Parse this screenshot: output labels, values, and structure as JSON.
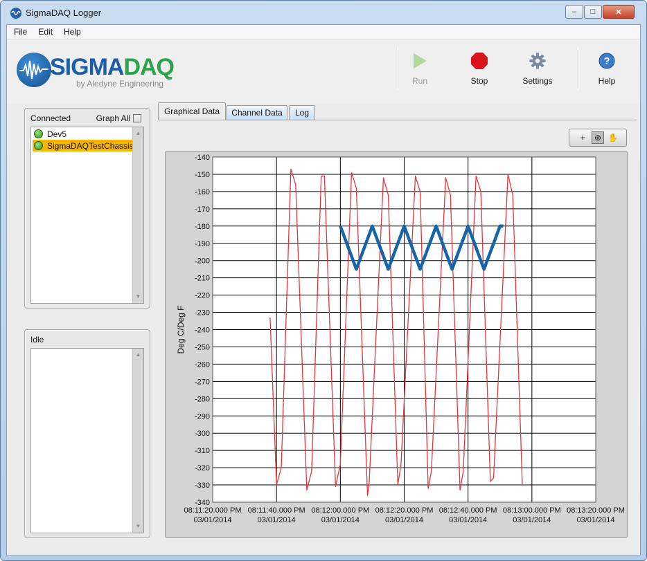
{
  "window": {
    "title": "SigmaDAQ Logger",
    "icon": "sigmadaq-app-icon"
  },
  "window_controls": {
    "minimize": "–",
    "maximize": "□",
    "close": "✕"
  },
  "menu": [
    {
      "label": "File"
    },
    {
      "label": "Edit"
    },
    {
      "label": "Help"
    }
  ],
  "logo": {
    "main_left": "SIGMA",
    "main_right": "DAQ",
    "sub": "by Aledyne Engineering",
    "icon": "sine-wave-logo-icon"
  },
  "toolbar": {
    "run": {
      "label": "Run",
      "icon": "play-icon",
      "enabled": false
    },
    "stop": {
      "label": "Stop",
      "icon": "stop-icon",
      "enabled": true
    },
    "settings": {
      "label": "Settings",
      "icon": "gear-icon",
      "enabled": true
    },
    "help": {
      "label": "Help",
      "icon": "help-icon",
      "enabled": true
    }
  },
  "connected_panel": {
    "title": "Connected",
    "graph_all_label": "Graph All",
    "graph_all_checked": false,
    "items": [
      {
        "label": "Dev5",
        "status": "green-led-icon",
        "selected": false
      },
      {
        "label": "SigmaDAQTestChassis",
        "status": "green-led-icon",
        "selected": true
      }
    ]
  },
  "idle_panel": {
    "title": "Idle",
    "items": []
  },
  "tabs": [
    {
      "label": "Graphical Data",
      "active": true
    },
    {
      "label": "Channel Data",
      "active": false
    },
    {
      "label": "Log",
      "active": false
    }
  ],
  "graph_tools": [
    {
      "name": "cursor-tool-icon",
      "glyph": "+",
      "pressed": false
    },
    {
      "name": "zoom-tool-icon",
      "glyph": "⊕",
      "pressed": true
    },
    {
      "name": "pan-tool-icon",
      "glyph": "✋",
      "pressed": false
    }
  ],
  "colors": {
    "selected_item": "#f7b500",
    "series_red": "#e8333a",
    "series_blue": "#1565a8",
    "logo_blue": "#1c5da6",
    "logo_green": "#2aa34a"
  },
  "chart_data": {
    "type": "line",
    "ylabel": "Deg C/Deg F",
    "xlabel": "",
    "ylim": [
      -340,
      -140
    ],
    "yticks": [
      -140,
      -150,
      -160,
      -170,
      -180,
      -190,
      -200,
      -210,
      -220,
      -230,
      -240,
      -250,
      -260,
      -270,
      -280,
      -290,
      -300,
      -310,
      -320,
      -330,
      -340
    ],
    "xlim_seconds": [
      0,
      120
    ],
    "xticks": [
      {
        "time": "08:11:20.000 PM",
        "date": "03/01/2014"
      },
      {
        "time": "08:11:40.000 PM",
        "date": "03/01/2014"
      },
      {
        "time": "08:12:00.000 PM",
        "date": "03/01/2014"
      },
      {
        "time": "08:12:20.000 PM",
        "date": "03/01/2014"
      },
      {
        "time": "08:12:40.000 PM",
        "date": "03/01/2014"
      },
      {
        "time": "08:13:00.000 PM",
        "date": "03/01/2014"
      },
      {
        "time": "08:13:20.000 PM",
        "date": "03/01/2014"
      }
    ],
    "grid": true,
    "series": [
      {
        "color": "#e8333a",
        "width": 1.3,
        "points": [
          [
            18.0,
            -233
          ],
          [
            20.0,
            -330
          ],
          [
            21.5,
            -320
          ],
          [
            24.5,
            -147
          ],
          [
            26.0,
            -156
          ],
          [
            29.5,
            -333
          ],
          [
            31.0,
            -322
          ],
          [
            34.0,
            -151
          ],
          [
            35.0,
            -151
          ],
          [
            38.5,
            -331
          ],
          [
            40.0,
            -318
          ],
          [
            43.5,
            -149
          ],
          [
            45.0,
            -158
          ],
          [
            48.5,
            -336
          ],
          [
            49.0,
            -330
          ],
          [
            53.5,
            -152
          ],
          [
            55.0,
            -162
          ],
          [
            58.0,
            -330
          ],
          [
            59.0,
            -318
          ],
          [
            63.5,
            -151
          ],
          [
            65.0,
            -160
          ],
          [
            67.5,
            -332
          ],
          [
            68.5,
            -322
          ],
          [
            73.0,
            -152
          ],
          [
            74.5,
            -162
          ],
          [
            77.5,
            -333
          ],
          [
            78.5,
            -322
          ],
          [
            82.5,
            -151
          ],
          [
            84.0,
            -160
          ],
          [
            87.0,
            -328
          ],
          [
            88.0,
            -326
          ],
          [
            92.5,
            -150
          ],
          [
            94.0,
            -162
          ],
          [
            97.0,
            -330
          ]
        ]
      },
      {
        "color": "#1565a8",
        "width": 4.5,
        "points": [
          [
            40.0,
            -180
          ],
          [
            45.0,
            -205
          ],
          [
            50.0,
            -180
          ],
          [
            55.0,
            -205
          ],
          [
            60.0,
            -180
          ],
          [
            65.0,
            -205
          ],
          [
            70.0,
            -180
          ],
          [
            75.0,
            -205
          ],
          [
            80.0,
            -180
          ],
          [
            85.0,
            -205
          ],
          [
            90.0,
            -180
          ],
          [
            91.0,
            -180
          ]
        ]
      }
    ]
  }
}
